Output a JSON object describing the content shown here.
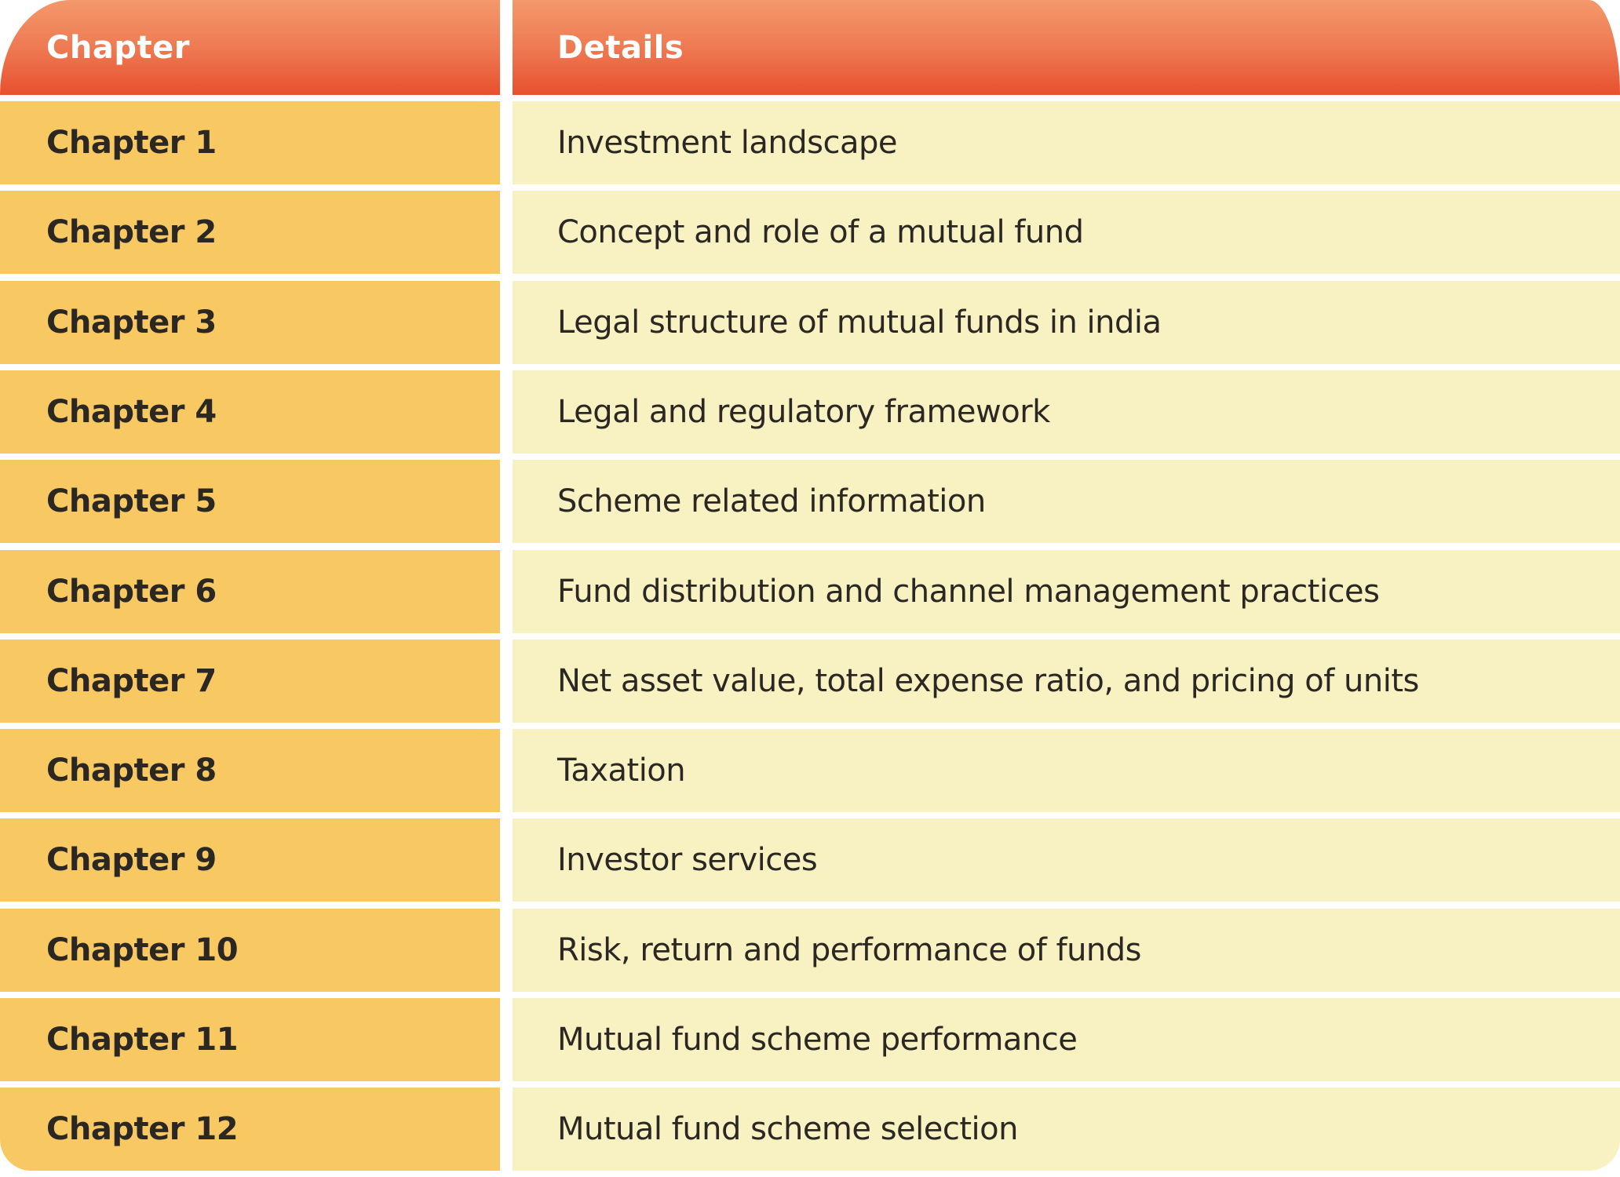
{
  "header": {
    "chapter_label": "Chapter",
    "details_label": "Details"
  },
  "colors": {
    "header_gradient_top": "#f3996b",
    "header_gradient_bottom": "#e8502f",
    "chapter_cell_bg": "#f8c962",
    "details_cell_bg": "#f8f1c2",
    "text_dark": "#2b2824"
  },
  "rows": [
    {
      "chapter": "Chapter 1",
      "details": "Investment landscape"
    },
    {
      "chapter": "Chapter 2",
      "details": "Concept and role of a mutual fund"
    },
    {
      "chapter": "Chapter 3",
      "details": "Legal structure of mutual funds in india"
    },
    {
      "chapter": "Chapter 4",
      "details": "Legal and regulatory framework"
    },
    {
      "chapter": "Chapter 5",
      "details": "Scheme related information"
    },
    {
      "chapter": "Chapter 6",
      "details": "Fund distribution and channel management practices"
    },
    {
      "chapter": "Chapter 7",
      "details": "Net asset value, total expense ratio, and pricing of units"
    },
    {
      "chapter": "Chapter 8",
      "details": "Taxation"
    },
    {
      "chapter": "Chapter 9",
      "details": "Investor services"
    },
    {
      "chapter": "Chapter 10",
      "details": "Risk, return and performance of funds"
    },
    {
      "chapter": "Chapter 11",
      "details": "Mutual fund scheme performance"
    },
    {
      "chapter": "Chapter 12",
      "details": "Mutual fund scheme selection"
    }
  ]
}
